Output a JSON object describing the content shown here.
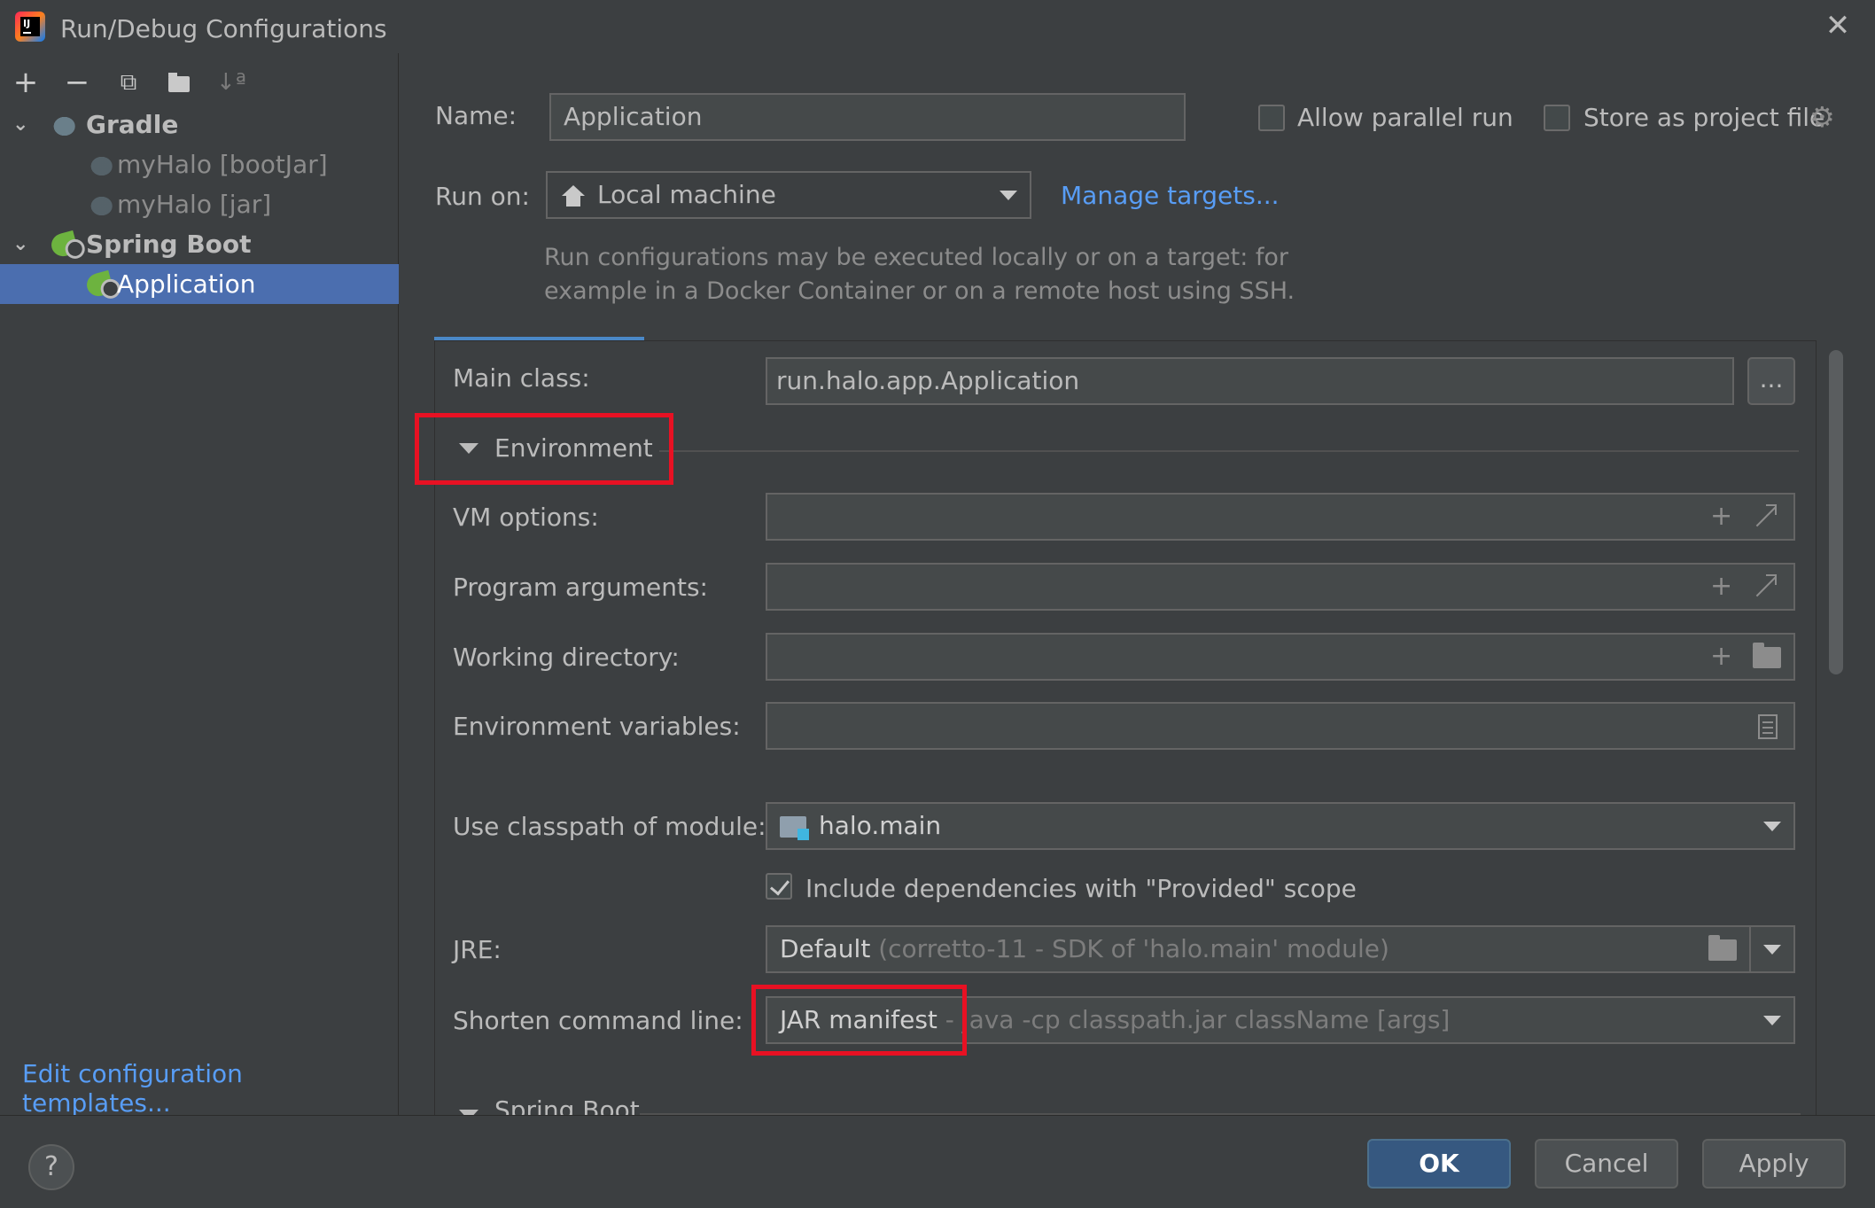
{
  "window": {
    "title": "Run/Debug Configurations"
  },
  "toolbar": {
    "add": "+",
    "remove": "−",
    "copy": "copy-icon",
    "folder": "new-folder-icon",
    "sort": "sort-icon"
  },
  "tree": {
    "gradle": "Gradle",
    "gradle_items": [
      "myHalo [bootJar]",
      "myHalo [jar]"
    ],
    "spring_boot": "Spring Boot",
    "spring_items": [
      "Application"
    ]
  },
  "left_footer": {
    "edit_templates": "Edit configuration templates..."
  },
  "form": {
    "name_label": "Name:",
    "name_value": "Application",
    "allow_parallel_label": "Allow parallel run",
    "allow_parallel_checked": false,
    "store_project_label": "Store as project file",
    "store_project_checked": false,
    "run_on_label": "Run on:",
    "run_on_value": "Local machine",
    "manage_targets": "Manage targets...",
    "hint_line1": "Run configurations may be executed locally or on a target: for",
    "hint_line2": "example in a Docker Container or on a remote host using SSH.",
    "main_class_label": "Main class:",
    "main_class_value": "run.halo.app.Application",
    "browse": "...",
    "environment_section": "Environment",
    "vm_options_label": "VM options:",
    "program_args_label": "Program arguments:",
    "working_dir_label": "Working directory:",
    "env_vars_label": "Environment variables:",
    "classpath_label": "Use classpath of module:",
    "classpath_value": "halo.main",
    "include_provided_label": "Include dependencies with \"Provided\" scope",
    "include_provided_checked": true,
    "jre_label": "JRE:",
    "jre_value": "Default",
    "jre_detail": "(corretto-11 - SDK of 'halo.main' module)",
    "shorten_label": "Shorten command line:",
    "shorten_value": "JAR manifest",
    "shorten_detail": "- java -cp classpath.jar className [args]",
    "spring_boot_section": "Spring Boot"
  },
  "buttons": {
    "help": "?",
    "ok": "OK",
    "cancel": "Cancel",
    "apply": "Apply"
  },
  "colors": {
    "background": "#3c3f41",
    "selection": "#4b6eaf",
    "link": "#589df6",
    "highlight": "#e81123",
    "primary": "#365880"
  }
}
